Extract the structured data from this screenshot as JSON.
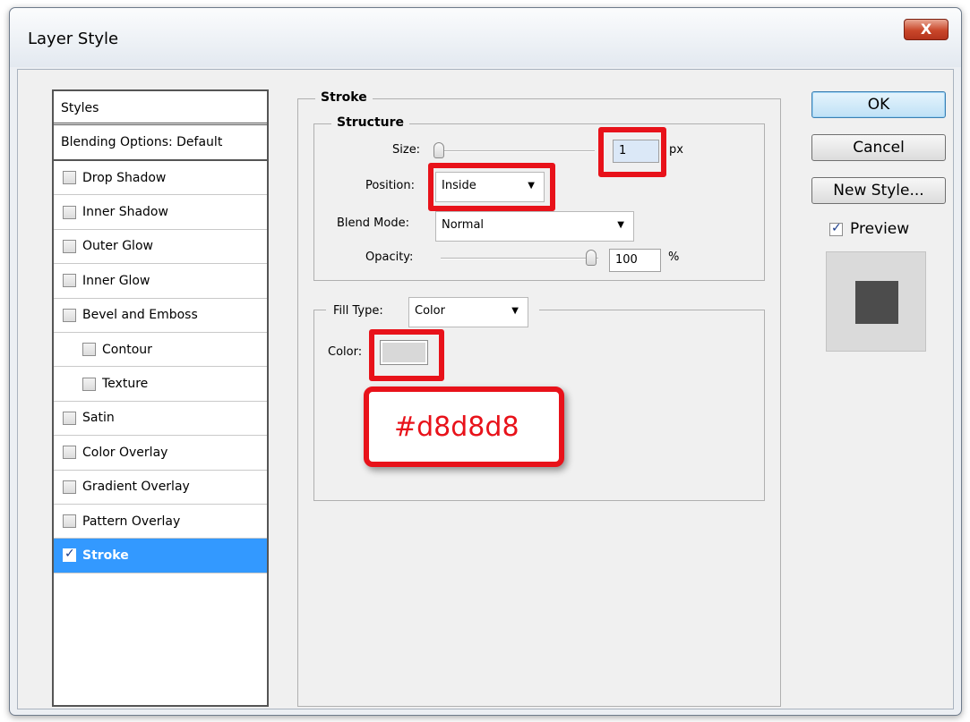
{
  "window": {
    "title": "Layer Style",
    "close_label": "X"
  },
  "styles_panel": {
    "header": "Styles",
    "blending": "Blending Options: Default",
    "items": [
      {
        "label": "Drop Shadow",
        "checked": false
      },
      {
        "label": "Inner Shadow",
        "checked": false
      },
      {
        "label": "Outer Glow",
        "checked": false
      },
      {
        "label": "Inner Glow",
        "checked": false
      },
      {
        "label": "Bevel and Emboss",
        "checked": false
      },
      {
        "label": "Contour",
        "checked": false
      },
      {
        "label": "Texture",
        "checked": false
      },
      {
        "label": "Satin",
        "checked": false
      },
      {
        "label": "Color Overlay",
        "checked": false
      },
      {
        "label": "Gradient Overlay",
        "checked": false
      },
      {
        "label": "Pattern Overlay",
        "checked": false
      },
      {
        "label": "Stroke",
        "checked": true
      }
    ]
  },
  "stroke": {
    "group_title": "Stroke",
    "structure_title": "Structure",
    "size_label": "Size:",
    "size_value": "1",
    "size_unit": "px",
    "position_label": "Position:",
    "position_value": "Inside",
    "blend_label": "Blend Mode:",
    "blend_value": "Normal",
    "opacity_label": "Opacity:",
    "opacity_value": "100",
    "opacity_unit": "%",
    "fill_type_label": "Fill Type:",
    "fill_type_value": "Color",
    "color_label": "Color:",
    "color_value": "#d8d8d8",
    "annotation": "#d8d8d8"
  },
  "buttons": {
    "ok": "OK",
    "cancel": "Cancel",
    "new_style": "New Style...",
    "preview": "Preview"
  },
  "colors": {
    "highlight": "#e8121a",
    "selection": "#3399ff",
    "swatch": "#d8d8d8"
  }
}
